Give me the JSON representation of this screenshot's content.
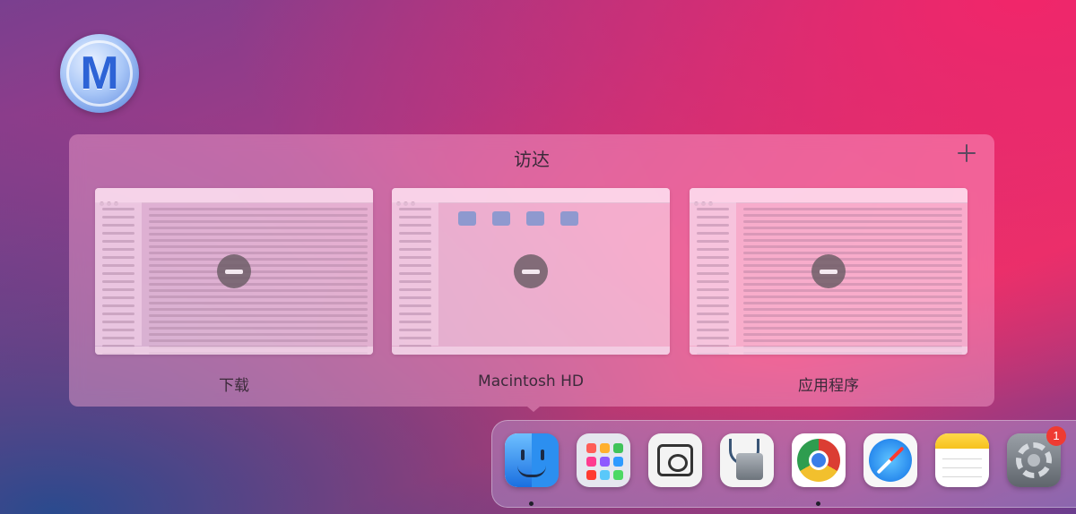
{
  "switcher": {
    "title": "访达",
    "windows": [
      {
        "label": "下载"
      },
      {
        "label": "Macintosh HD"
      },
      {
        "label": "应用程序"
      }
    ]
  },
  "dock": {
    "apps": [
      {
        "name": "finder-icon",
        "running": true
      },
      {
        "name": "launchpad-icon",
        "running": false
      },
      {
        "name": "screenshot-icon",
        "running": false
      },
      {
        "name": "disk-utility-icon",
        "running": false
      },
      {
        "name": "chrome-icon",
        "running": true
      },
      {
        "name": "safari-icon",
        "running": false
      },
      {
        "name": "notes-icon",
        "running": false
      },
      {
        "name": "system-settings-icon",
        "running": false,
        "badge": "1"
      }
    ]
  },
  "colors": {
    "badge": "#ef3b32",
    "accent_pink": "#e8336a",
    "accent_purple": "#7a3f8f"
  }
}
